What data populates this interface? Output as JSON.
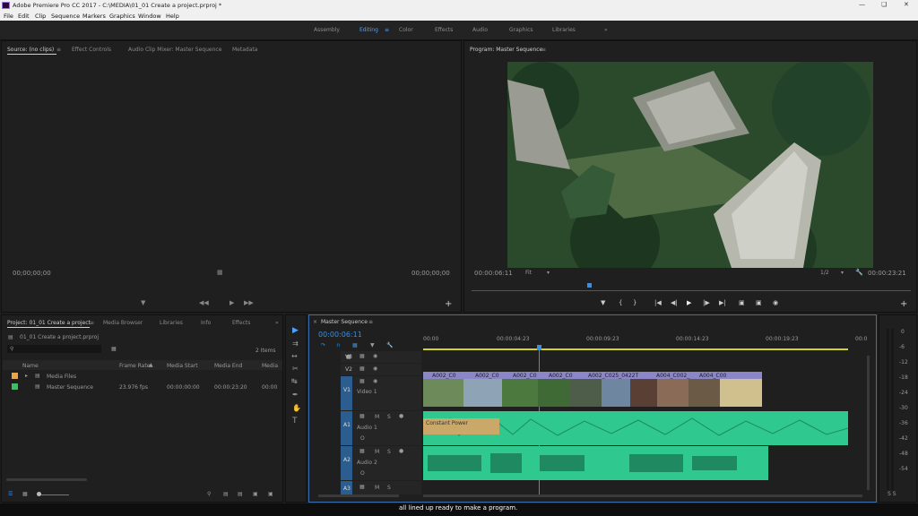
{
  "window": {
    "title": "Adobe Premiere Pro CC 2017 - C:\\MEDIA\\01_01 Create a project.prproj *"
  },
  "menu": [
    "File",
    "Edit",
    "Clip",
    "Sequence",
    "Markers",
    "Graphics",
    "Window",
    "Help"
  ],
  "workspaces": [
    "Assembly",
    "Editing",
    "Color",
    "Effects",
    "Audio",
    "Graphics",
    "Libraries"
  ],
  "source_panel": {
    "tabs": [
      "Source: (no clips)",
      "Effect Controls",
      "Audio Clip Mixer: Master Sequence",
      "Metadata"
    ],
    "timecode_left": "00;00;00;00",
    "timecode_right": "00;00;00;00"
  },
  "program_panel": {
    "title": "Program: Master Sequence",
    "timecode": "00:00:06:11",
    "fit": "Fit",
    "quality": "1/2",
    "duration": "00:00:23:21"
  },
  "project_panel": {
    "tabs": [
      "Project: 01_01 Create a project",
      "Media Browser",
      "Libraries",
      "Info",
      "Effects"
    ],
    "filename": "01_01 Create a project.prproj",
    "item_count": "2 Items",
    "columns": [
      "Name",
      "Frame Rate",
      "Media Start",
      "Media End",
      "Media"
    ],
    "rows": [
      {
        "name": "Media Files",
        "frame_rate": "",
        "start": "",
        "end": "",
        "color": "#e8a54a"
      },
      {
        "name": "Master Sequence",
        "frame_rate": "23.976 fps",
        "start": "00:00:00:00",
        "end": "00:00:23:20",
        "dur": "00:00",
        "color": "#3cc064"
      }
    ]
  },
  "timeline": {
    "tab": "Master Sequence",
    "timecode": "00:00:06:11",
    "ruler": [
      "00:00",
      "00:00:04:23",
      "00:00:09:23",
      "00:00:14:23",
      "00:00:19:23",
      "00:0"
    ],
    "tracks_video": [
      "V3",
      "V2",
      "V1"
    ],
    "video_label": "Video 1",
    "tracks_audio": [
      "A1",
      "A2",
      "A3"
    ],
    "audio_labels": [
      "Audio 1",
      "Audio 2"
    ],
    "clips": [
      "A002_C0",
      "A002_C0",
      "A002_C0",
      "A002_C0",
      "A002_C025_0422T",
      "A004_C002_",
      "A004_C00"
    ],
    "audio_clip": "Constant Power",
    "letters": {
      "m": "M",
      "s": "S",
      "o": "O"
    }
  },
  "meter_labels": [
    "0",
    "-6",
    "-12",
    "-18",
    "-24",
    "-30",
    "-36",
    "-42",
    "-48",
    "-54",
    "S S"
  ],
  "caption": "all lined up ready to make a program."
}
